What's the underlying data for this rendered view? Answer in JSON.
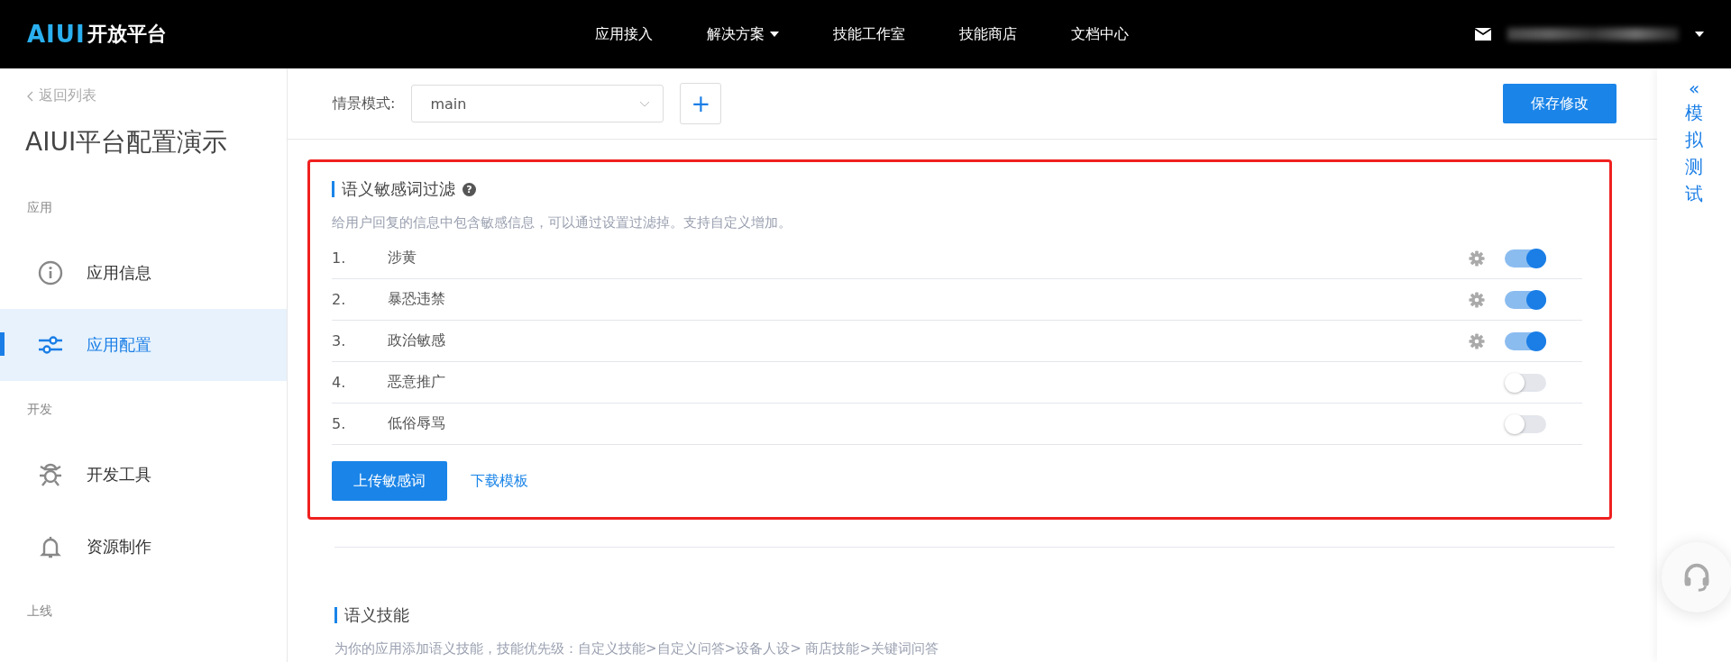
{
  "header": {
    "logo_mark": "AIUI",
    "logo_text": "开放平台",
    "nav": [
      {
        "label": "应用接入",
        "dropdown": false
      },
      {
        "label": "解决方案",
        "dropdown": true
      },
      {
        "label": "技能工作室",
        "dropdown": false
      },
      {
        "label": "技能商店",
        "dropdown": false
      },
      {
        "label": "文档中心",
        "dropdown": false
      }
    ]
  },
  "sidebar": {
    "back": "返回列表",
    "app_title": "AIUI平台配置演示",
    "groups": [
      {
        "label": "应用",
        "items": [
          {
            "label": "应用信息",
            "kind": "info",
            "selected": false
          },
          {
            "label": "应用配置",
            "kind": "sliders",
            "selected": true
          }
        ]
      },
      {
        "label": "开发",
        "items": [
          {
            "label": "开发工具",
            "kind": "bug",
            "selected": false
          },
          {
            "label": "资源制作",
            "kind": "bell",
            "selected": false
          }
        ]
      },
      {
        "label": "上线"
      }
    ]
  },
  "toolbar": {
    "mode_label": "情景模式:",
    "mode_value": "main",
    "add": "+",
    "save": "保存修改"
  },
  "filter": {
    "title": "语义敏感词过滤",
    "help": "?",
    "description": "给用户回复的信息中包含敏感信息，可以通过设置过滤掉。支持自定义增加。",
    "rows": [
      {
        "index": "1.",
        "name": "涉黄",
        "on": true
      },
      {
        "index": "2.",
        "name": "暴恐违禁",
        "on": true
      },
      {
        "index": "3.",
        "name": "政治敏感",
        "on": true
      },
      {
        "index": "4.",
        "name": "恶意推广",
        "on": false
      },
      {
        "index": "5.",
        "name": "低俗辱骂",
        "on": false
      }
    ],
    "upload": "上传敏感词",
    "download": "下载模板"
  },
  "skills": {
    "title": "语义技能",
    "description": "为你的应用添加语义技能，技能优先级：自定义技能>自定义问答>设备人设> 商店技能>关键词问答"
  },
  "side_panel": {
    "arrow": "«",
    "label": "模拟测试"
  }
}
